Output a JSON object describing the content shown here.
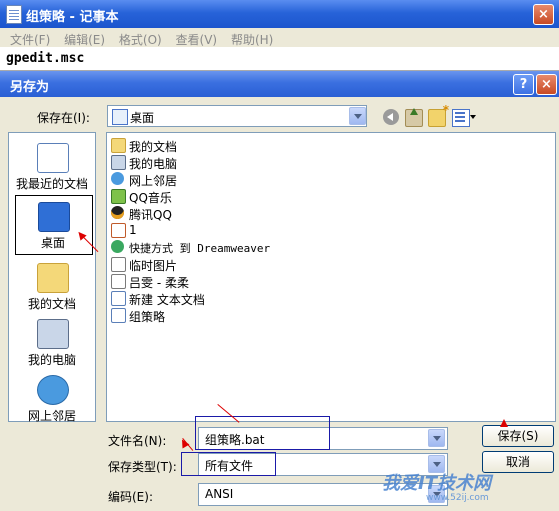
{
  "notepad": {
    "title": "组策略 - 记事本",
    "menu": [
      "文件(F)",
      "编辑(E)",
      "格式(O)",
      "查看(V)",
      "帮助(H)"
    ],
    "content": "gpedit.msc"
  },
  "dialog": {
    "title": "另存为",
    "help_label": "?",
    "close_label": "×",
    "save_in_label": "保存在(I):",
    "save_in_value": "桌面",
    "places": [
      {
        "label": "我最近的文档",
        "icon": "recent-documents-icon"
      },
      {
        "label": "桌面",
        "icon": "desktop-icon"
      },
      {
        "label": "我的文档",
        "icon": "my-documents-icon"
      },
      {
        "label": "我的电脑",
        "icon": "my-computer-icon"
      },
      {
        "label": "网上邻居",
        "icon": "network-places-icon"
      }
    ],
    "files": [
      {
        "name": "我的文档",
        "icon": "my-documents-icon"
      },
      {
        "name": "我的电脑",
        "icon": "my-computer-icon"
      },
      {
        "name": "网上邻居",
        "icon": "network-places-icon"
      },
      {
        "name": "QQ音乐",
        "icon": "qq-music-icon"
      },
      {
        "name": "腾讯QQ",
        "icon": "qq-icon"
      },
      {
        "name": "1",
        "icon": "file-icon"
      },
      {
        "name": "快捷方式 到 Dreamweaver",
        "icon": "shortcut-icon"
      },
      {
        "name": "临时图片",
        "icon": "file-icon"
      },
      {
        "name": "吕雯 - 柔柔",
        "icon": "file-icon"
      },
      {
        "name": "新建 文本文档",
        "icon": "text-file-icon"
      },
      {
        "name": "组策略",
        "icon": "text-file-icon"
      }
    ],
    "filename_label": "文件名(N):",
    "filename_value": "组策略.bat",
    "filetype_label": "保存类型(T):",
    "filetype_value": "所有文件",
    "encoding_label": "编码(E):",
    "encoding_value": "ANSI",
    "save_button": "保存(S)",
    "cancel_button": "取消"
  },
  "watermark": {
    "text": "我爱IT技术网",
    "url": "www.52ij.com"
  },
  "colors": {
    "title_blue": "#2763d9",
    "annotation_red": "#dd0000",
    "dialog_bg": "#ECE9D8"
  }
}
